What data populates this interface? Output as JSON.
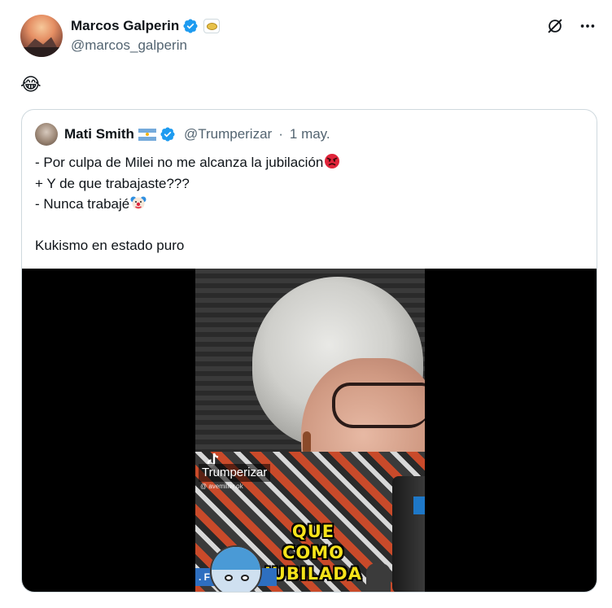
{
  "author": {
    "display_name": "Marcos Galperin",
    "handle": "@marcos_galperin",
    "verified_icon": "verified-badge-icon",
    "affiliate_icon": "affiliate-badge-icon"
  },
  "actions": {
    "grok_icon": "grok-icon",
    "more_icon": "more-options-icon"
  },
  "tweet": {
    "text": "😂"
  },
  "quoted": {
    "display_name": "Mati Smith",
    "flag_icon": "argentina-flag-icon",
    "handle": "@Trumperizar",
    "separator": "·",
    "date": "1 may.",
    "lines": [
      "- Por culpa de Milei no me alcanza la jubilación",
      "+ Y de que trabajaste???",
      "- Nunca trabajé",
      "",
      "Kukismo en estado puro"
    ],
    "line_emojis": [
      "angry-face-icon",
      "",
      "clown-face-icon",
      "",
      ""
    ]
  },
  "media": {
    "type": "video",
    "watermark_name": "Trumperizar",
    "watermark_sub": "@ avemiller.ok",
    "caption_line1": "QUE COMO",
    "caption_line2": "JUBILADA",
    "bottom_bar_text": ". F"
  },
  "colors": {
    "text_primary": "#0f1419",
    "text_secondary": "#536471",
    "verified_blue": "#1d9bf0",
    "border": "#cfd9de",
    "caption_yellow": "#f5e21a"
  }
}
